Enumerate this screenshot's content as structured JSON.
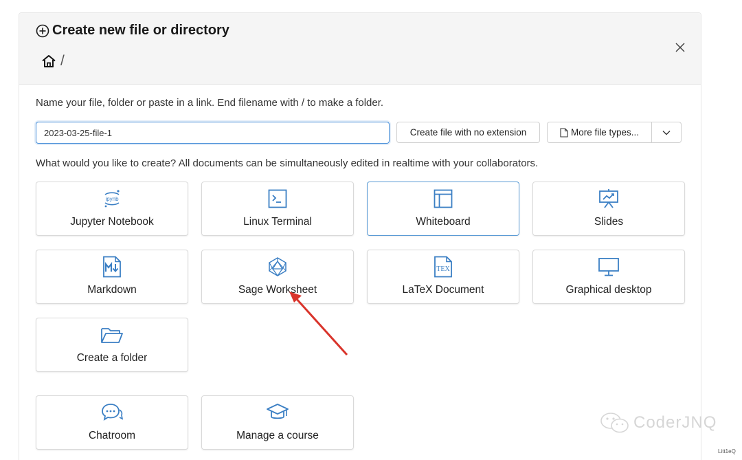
{
  "dialog": {
    "title": "Create new file or directory",
    "breadcrumb_sep": "/",
    "instruction": "Name your file, folder or paste in a link. End filename with / to make a folder.",
    "filename_value": "2023-03-25-file-1",
    "no_extension_label": "Create file with no extension",
    "more_types_label": "More file types...",
    "question": "What would you like to create? All documents can be simultaneously edited in realtime with your collaborators."
  },
  "cards": [
    {
      "label": "Jupyter Notebook",
      "icon": "jupyter-icon"
    },
    {
      "label": "Linux Terminal",
      "icon": "terminal-icon"
    },
    {
      "label": "Whiteboard",
      "icon": "whiteboard-icon"
    },
    {
      "label": "Slides",
      "icon": "slides-icon"
    },
    {
      "label": "Markdown",
      "icon": "markdown-icon"
    },
    {
      "label": "Sage Worksheet",
      "icon": "sage-icon"
    },
    {
      "label": "LaTeX Document",
      "icon": "latex-icon"
    },
    {
      "label": "Graphical desktop",
      "icon": "desktop-icon"
    },
    {
      "label": "Create a folder",
      "icon": "folder-icon"
    },
    {
      "label": "Chatroom",
      "icon": "chat-icon"
    },
    {
      "label": "Manage a course",
      "icon": "graduation-cap-icon"
    }
  ],
  "icon_glyphs": {
    "jupyter_text": "ipynb",
    "latex_text": "TEX"
  },
  "watermark": {
    "text": "CoderJNQ",
    "small": "Litt1eQ"
  },
  "colors": {
    "accent": "#3b7fc4",
    "selected_border": "#5b9bd5",
    "arrow": "#d9342b"
  }
}
